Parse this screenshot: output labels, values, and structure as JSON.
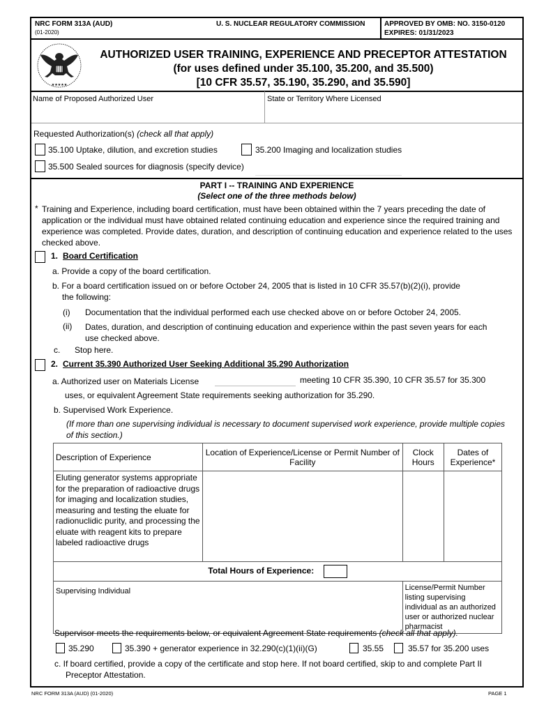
{
  "header": {
    "form_number": "NRC FORM 313A (AUD)",
    "form_date": "(01-2020)",
    "agency": "U. S. NUCLEAR REGULATORY COMMISSION",
    "omb": "APPROVED BY OMB: NO. 3150-0120",
    "expires": "EXPIRES:  01/31/2023",
    "seal_icon": "nrc-seal-icon"
  },
  "title": {
    "line1": "AUTHORIZED USER TRAINING, EXPERIENCE AND PRECEPTOR ATTESTATION",
    "line2": "(for uses defined under 35.100, 35.200, and 35.500)",
    "line3": "[10 CFR 35.57, 35.190, 35.290, and 35.590]"
  },
  "fields": {
    "name_label": "Name of Proposed Authorized User",
    "name_value": "",
    "state_label": "State or Territory Where Licensed",
    "state_value": ""
  },
  "requested": {
    "label": "Requested Authorization(s)",
    "hint": "(check all that apply)",
    "options": [
      {
        "label": "35.100 Uptake, dilution, and excretion studies",
        "checked": false
      },
      {
        "label": "35.200 Imaging and localization studies",
        "checked": false
      },
      {
        "label": "35.500 Sealed sources for diagnosis (specify device)",
        "checked": false
      }
    ],
    "device_value": ""
  },
  "part1": {
    "heading": "PART I -- TRAINING AND EXPERIENCE",
    "subheading": "(Select one of the three methods below)",
    "note_star": "*",
    "note": "Training and Experience, including board certification, must have been obtained within the 7 years preceding the date of application or the individual must have obtained related continuing education and experience since the required training and experience was completed.  Provide dates, duration, and description of continuing education and experience related to the uses checked above.",
    "method1": {
      "number": "1.",
      "title": "Board Certification",
      "checked": false,
      "a": "a. Provide a copy of the board certification.",
      "b": "b. For a board certification issued on or before October 24, 2005 that is listed in 10 CFR 35.57(b)(2)(i), provide the following:",
      "b_i_num": "(i)",
      "b_i": "Documentation that the individual performed each use checked above on or before October 24, 2005.",
      "b_ii_num": "(ii)",
      "b_ii": "Dates, duration, and description of continuing education and experience within the past seven years for each use checked above.",
      "c_num": "c.",
      "c": "Stop here."
    },
    "method2": {
      "number": "2.",
      "title": "Current 35.390 Authorized User Seeking Additional 35.290 Authorization",
      "checked": false,
      "a_pre": "a.  Authorized user on Materials License",
      "license_value": "",
      "a_post": "meeting 10 CFR 35.390, 10 CFR 35.57 for 35.300",
      "a_cont": "uses, or equivalent Agreement State requirements seeking authorization for 35.290.",
      "b": "b. Supervised Work Experience.",
      "b_note": "(If more than one supervising individual is necessary to document supervised work experience, provide multiple copies of this section.)",
      "table": {
        "headers": [
          "Description of Experience",
          "Location of Experience/License or Permit Number of Facility",
          "Clock Hours",
          "Dates of Experience*"
        ],
        "rows": [
          [
            "Eluting generator systems appropriate for the preparation of radioactive drugs for imaging and localization studies, measuring and testing the eluate for radionuclidic purity, and processing the eluate with reagent kits to prepare labeled radioactive drugs",
            "",
            "",
            ""
          ]
        ],
        "total_label": "Total Hours of Experience:",
        "total_value": "",
        "supervisor_label": "Supervising Individual",
        "supervisor_value": "",
        "license_label": "License/Permit Number listing supervising individual as an authorized user or authorized nuclear pharmacist",
        "license_value": ""
      },
      "supervisor_meets": "Supervisor meets the requirements below, or equivalent Agreement State requirements",
      "supervisor_hint": "(check all that apply).",
      "supervisor_options": [
        {
          "label": "35.290",
          "checked": false
        },
        {
          "label": "35.390 + generator experience in 32.290(c)(1)(ii)(G)",
          "checked": false
        },
        {
          "label": "35.55",
          "checked": false
        },
        {
          "label": "35.57 for 35.200 uses",
          "checked": false
        }
      ],
      "c": "c.  If board certified, provide a copy of the certificate and stop here.  If not board certified, skip to and complete Part II Preceptor Attestation."
    }
  },
  "footer": {
    "form_id": "NRC FORM 313A (AUD)  (01-2020)",
    "page": "PAGE 1"
  }
}
